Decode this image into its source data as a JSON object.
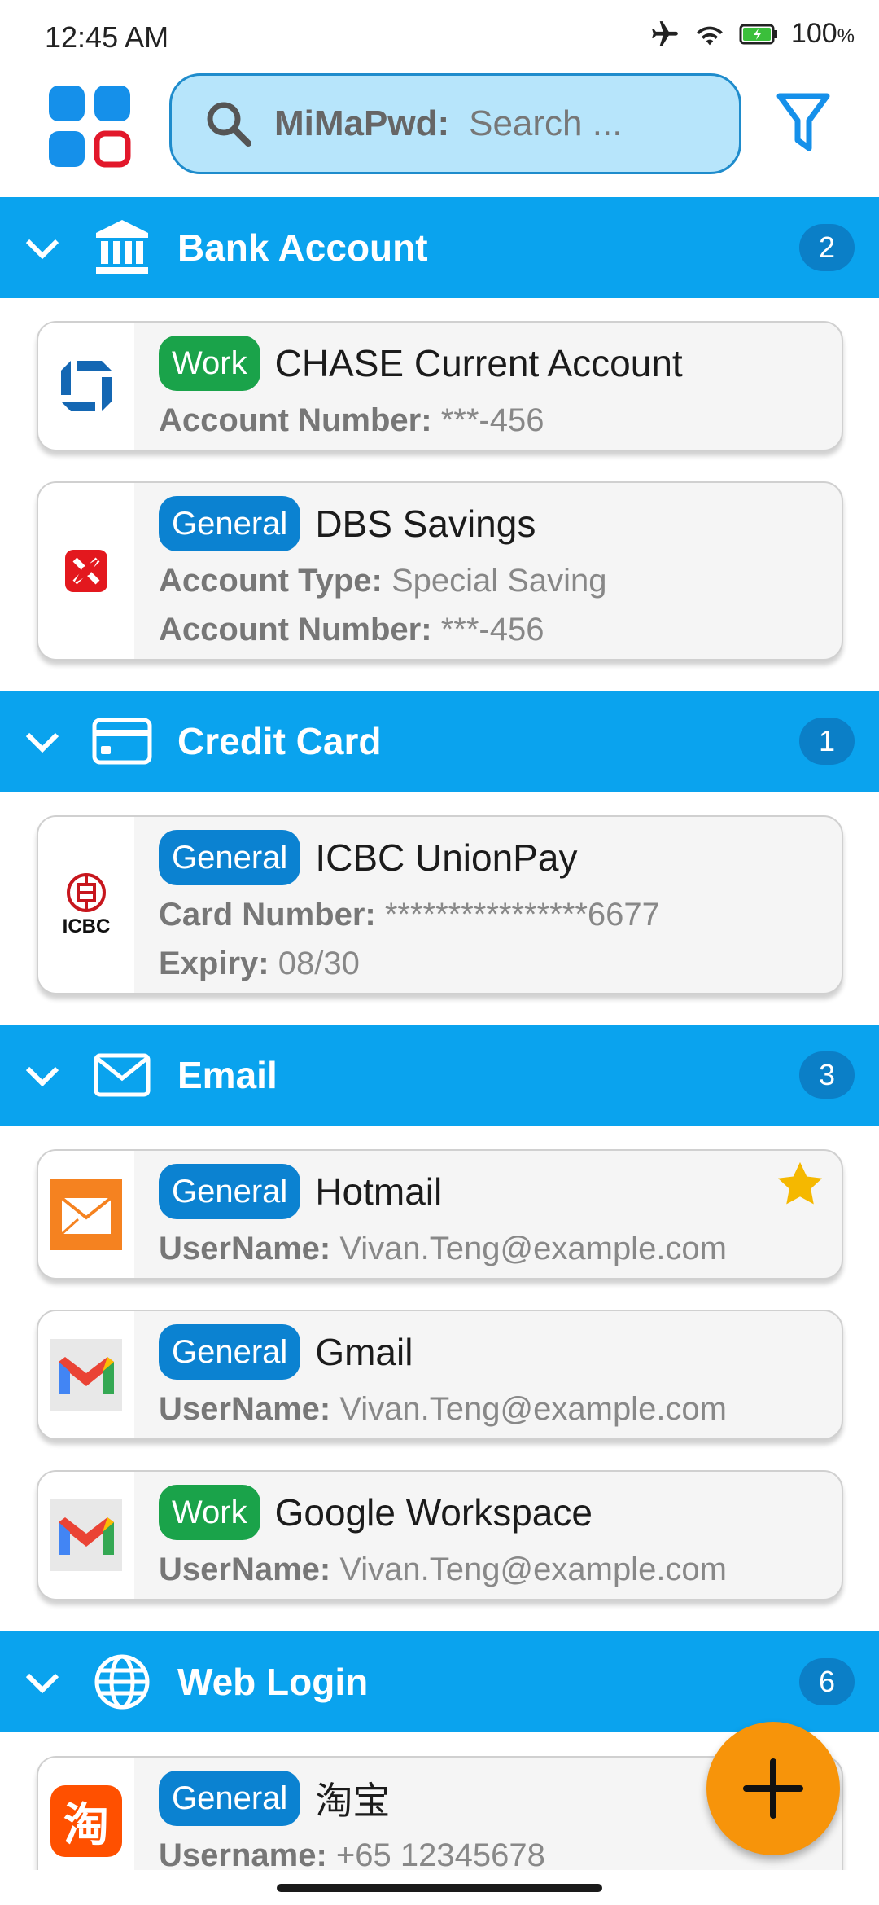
{
  "status": {
    "time": "12:45 AM",
    "battery": "100",
    "battery_unit": "%"
  },
  "search": {
    "prefix": "MiMaPwd:",
    "placeholder": "Search ..."
  },
  "colors": {
    "header_blue": "#0aa3ee",
    "tag_work": "#1aa34a",
    "tag_general": "#0b82d1",
    "fab": "#f7940a",
    "star": "#f5b800"
  },
  "sections": [
    {
      "title": "Bank Account",
      "count": "2",
      "icon": "bank-icon",
      "entries": [
        {
          "tag": "Work",
          "title": "CHASE Current Account",
          "logo": "chase-logo",
          "fields": [
            {
              "label": "Account Number:",
              "value": " ***-456"
            }
          ]
        },
        {
          "tag": "General",
          "title": "DBS Savings",
          "logo": "dbs-logo",
          "fields": [
            {
              "label": "Account Type:",
              "value": " Special Saving"
            },
            {
              "label": "Account Number:",
              "value": " ***-456"
            }
          ]
        }
      ]
    },
    {
      "title": "Credit Card",
      "count": "1",
      "icon": "credit-card-icon",
      "entries": [
        {
          "tag": "General",
          "title": "ICBC UnionPay",
          "logo": "icbc-logo",
          "logo_text": "ICBC",
          "fields": [
            {
              "label": "Card Number:",
              "value": " ****************6677"
            },
            {
              "label": "Expiry:",
              "value": " 08/30"
            }
          ]
        }
      ]
    },
    {
      "title": "Email",
      "count": "3",
      "icon": "mail-icon",
      "entries": [
        {
          "tag": "General",
          "title": "Hotmail",
          "logo": "hotmail-logo",
          "starred": true,
          "fields": [
            {
              "label": "UserName:",
              "value": " Vivan.Teng@example.com"
            }
          ]
        },
        {
          "tag": "General",
          "title": "Gmail",
          "logo": "gmail-logo",
          "fields": [
            {
              "label": "UserName:",
              "value": " Vivan.Teng@example.com"
            }
          ]
        },
        {
          "tag": "Work",
          "title": "Google Workspace",
          "logo": "gmail-logo",
          "fields": [
            {
              "label": "UserName:",
              "value": " Vivan.Teng@example.com"
            }
          ]
        }
      ]
    },
    {
      "title": "Web Login",
      "count": "6",
      "icon": "globe-icon",
      "entries": [
        {
          "tag": "General",
          "title": "淘宝",
          "logo": "taobao-logo",
          "logo_text": "淘",
          "fields": [
            {
              "label": "Username:",
              "value": " +65 12345678"
            }
          ]
        }
      ]
    }
  ]
}
